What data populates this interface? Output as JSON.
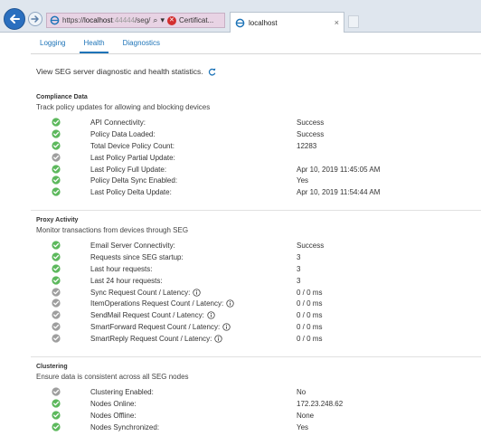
{
  "browser": {
    "address": {
      "scheme": "https://",
      "host": "localhost",
      "redacted": ":44444",
      "path": "/seg/",
      "search_glyph": "⌕",
      "certificate_label": "Certificat..."
    },
    "tab": {
      "label": "localhost",
      "close": "×"
    }
  },
  "subtabs": [
    {
      "label": "Logging",
      "active": false
    },
    {
      "label": "Health",
      "active": true
    },
    {
      "label": "Diagnostics",
      "active": false
    }
  ],
  "intro": {
    "text": "View SEG server diagnostic and health statistics."
  },
  "colors": {
    "success": "#5cb85c",
    "pending": "#9e9e9e",
    "accent": "#1e74b8"
  },
  "sections": {
    "compliance": {
      "title": "Compliance Data",
      "description": "Track policy updates for allowing and blocking devices",
      "rows": [
        {
          "label": "API Connectivity:",
          "value": "Success",
          "status": "success",
          "info": false
        },
        {
          "label": "Policy Data Loaded:",
          "value": "Success",
          "status": "success",
          "info": false
        },
        {
          "label": "Total Device Policy Count:",
          "value": "12283",
          "status": "success",
          "info": false
        },
        {
          "label": "Last Policy Partial Update:",
          "value": "",
          "status": "pending",
          "info": false
        },
        {
          "label": "Last Policy Full Update:",
          "value": "Apr 10, 2019 11:45:05 AM",
          "status": "success",
          "info": false
        },
        {
          "label": "Policy Delta Sync Enabled:",
          "value": "Yes",
          "status": "success",
          "info": false
        },
        {
          "label": "Last Policy Delta Update:",
          "value": "Apr 10, 2019 11:54:44 AM",
          "status": "success",
          "info": false
        }
      ]
    },
    "proxy": {
      "title": "Proxy Activity",
      "description": "Monitor transactions from devices through SEG",
      "rows": [
        {
          "label": "Email Server Connectivity:",
          "value": "Success",
          "status": "success",
          "info": false
        },
        {
          "label": "Requests since SEG startup:",
          "value": "3",
          "status": "success",
          "info": false
        },
        {
          "label": "Last hour requests:",
          "value": "3",
          "status": "success",
          "info": false
        },
        {
          "label": "Last 24 hour requests:",
          "value": "3",
          "status": "success",
          "info": false
        },
        {
          "label": "Sync Request Count / Latency:",
          "value": "0 / 0 ms",
          "status": "pending",
          "info": true
        },
        {
          "label": "ItemOperations Request Count / Latency:",
          "value": "0 / 0 ms",
          "status": "pending",
          "info": true
        },
        {
          "label": "SendMail Request Count / Latency:",
          "value": "0 / 0 ms",
          "status": "pending",
          "info": true
        },
        {
          "label": "SmartForward Request Count / Latency:",
          "value": "0 / 0 ms",
          "status": "pending",
          "info": true
        },
        {
          "label": "SmartReply Request Count / Latency:",
          "value": "0 / 0 ms",
          "status": "pending",
          "info": true
        }
      ]
    },
    "clustering": {
      "title": "Clustering",
      "description": "Ensure data is consistent across all SEG nodes",
      "rows": [
        {
          "label": "Clustering Enabled:",
          "value": "No",
          "status": "pending",
          "info": false
        },
        {
          "label": "Nodes Online:",
          "value": "172.23.248.62",
          "status": "success",
          "info": false
        },
        {
          "label": "Nodes Offline:",
          "value": "None",
          "status": "success",
          "info": false
        },
        {
          "label": "Nodes Synchronized:",
          "value": "Yes",
          "status": "success",
          "info": false
        }
      ]
    }
  }
}
